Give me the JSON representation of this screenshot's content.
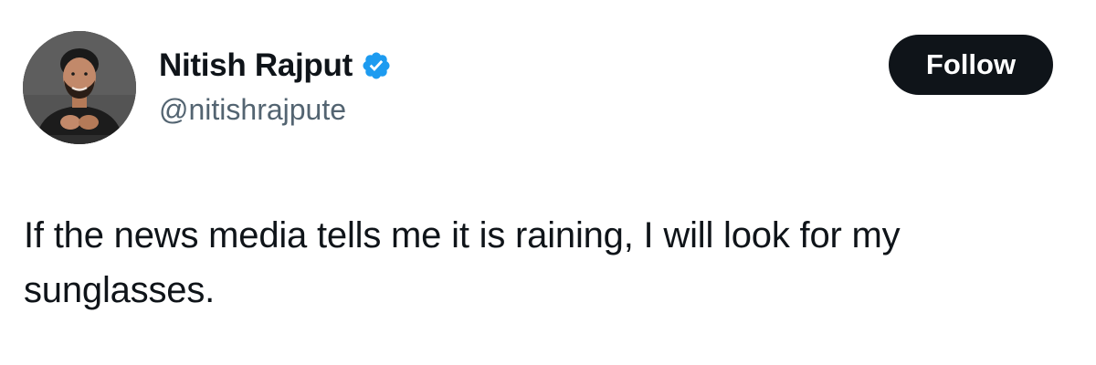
{
  "tweet": {
    "author": {
      "display_name": "Nitish Rajput",
      "handle": "@nitishrajpute",
      "verified": true,
      "avatar_icon": "profile-photo"
    },
    "follow_label": "Follow",
    "text": "If the news media tells me it is raining, I will look for my\nsunglasses."
  },
  "colors": {
    "text_primary": "#0f1419",
    "text_secondary": "#536471",
    "verified_blue": "#1d9bf0",
    "button_bg": "#0f1419",
    "button_text": "#ffffff"
  }
}
